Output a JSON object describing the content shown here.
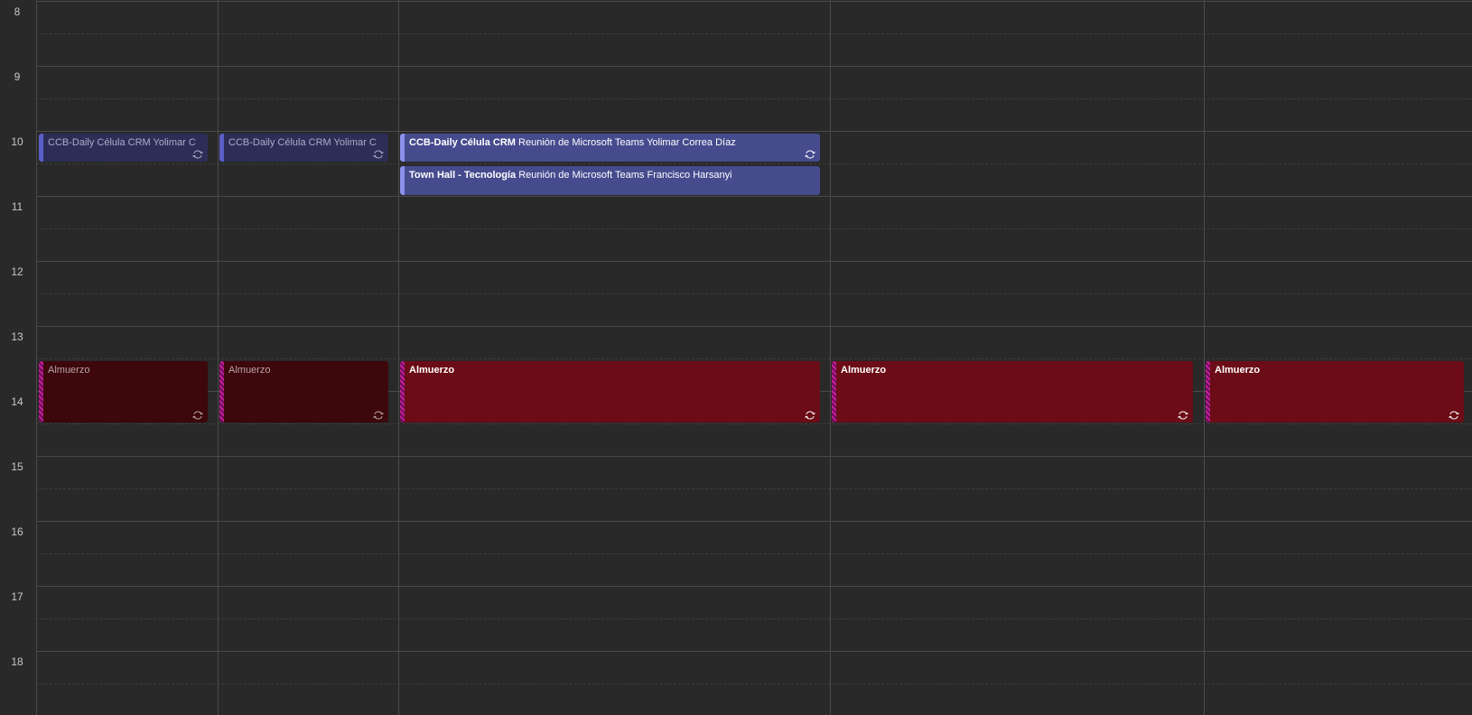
{
  "calendar": {
    "hours": [
      "8",
      "9",
      "10",
      "11",
      "12",
      "13",
      "14",
      "15",
      "16",
      "17",
      "18"
    ],
    "events": [
      {
        "id": "ccb-d1",
        "title": "CCB-Daily Célula CRM",
        "detail": "Yolimar C",
        "style": "dim-purple",
        "recurring": true
      },
      {
        "id": "ccb-d2",
        "title": "CCB-Daily Célula CRM",
        "detail": "Yolimar C",
        "style": "dim-purple",
        "recurring": true
      },
      {
        "id": "ccb-d3",
        "title": "CCB-Daily Célula CRM",
        "detail": "Reunión de Microsoft Teams Yolimar Correa Díaz",
        "style": "purple",
        "recurring": true
      },
      {
        "id": "townhall-d3",
        "title": "Town Hall - Tecnología",
        "detail": "Reunión de Microsoft Teams Francisco Harsanyi",
        "style": "purple",
        "recurring": false
      },
      {
        "id": "almuerzo-d1",
        "title": "Almuerzo",
        "detail": "",
        "style": "dim-red",
        "recurring": true
      },
      {
        "id": "almuerzo-d2",
        "title": "Almuerzo",
        "detail": "",
        "style": "dim-red",
        "recurring": true
      },
      {
        "id": "almuerzo-d3",
        "title": "Almuerzo",
        "detail": "",
        "style": "red",
        "recurring": true
      },
      {
        "id": "almuerzo-d4",
        "title": "Almuerzo",
        "detail": "",
        "style": "red",
        "recurring": true
      },
      {
        "id": "almuerzo-d5",
        "title": "Almuerzo",
        "detail": "",
        "style": "red",
        "recurring": true
      }
    ],
    "colors": {
      "background": "#292929",
      "teams_accent": "#5b5fc7",
      "lunch": "#6b0c16",
      "lunch_bar": "#c51f9e"
    },
    "icons": {
      "recurring": "recurring-icon"
    }
  }
}
